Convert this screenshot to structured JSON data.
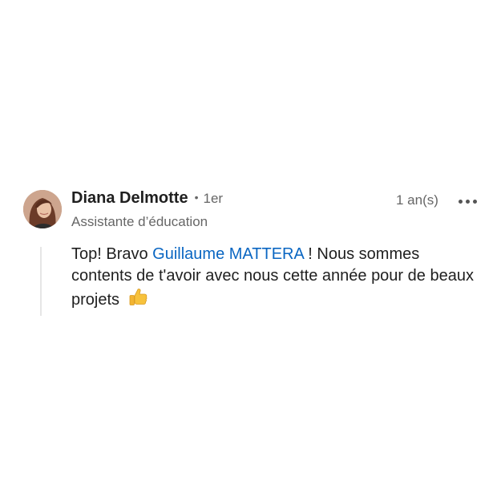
{
  "comment": {
    "author": {
      "name": "Diana Delmotte",
      "degree_separator": "•",
      "degree": "1er",
      "headline": "Assistante d’éducation"
    },
    "timestamp": "1 an(s)",
    "more_icon": "more-horizontal-icon",
    "body": {
      "text_before": "Top! Bravo ",
      "mention": "Guillaume MATTERA",
      "text_after_line1": " ! Nous sommes contents de t'avoir avec nous cette année pour de beaux projets ",
      "emoji": "thumbs-up-icon"
    }
  },
  "colors": {
    "mention": "#0a66c2",
    "primary_text": "#1f1f1f",
    "secondary_text": "#666666"
  }
}
